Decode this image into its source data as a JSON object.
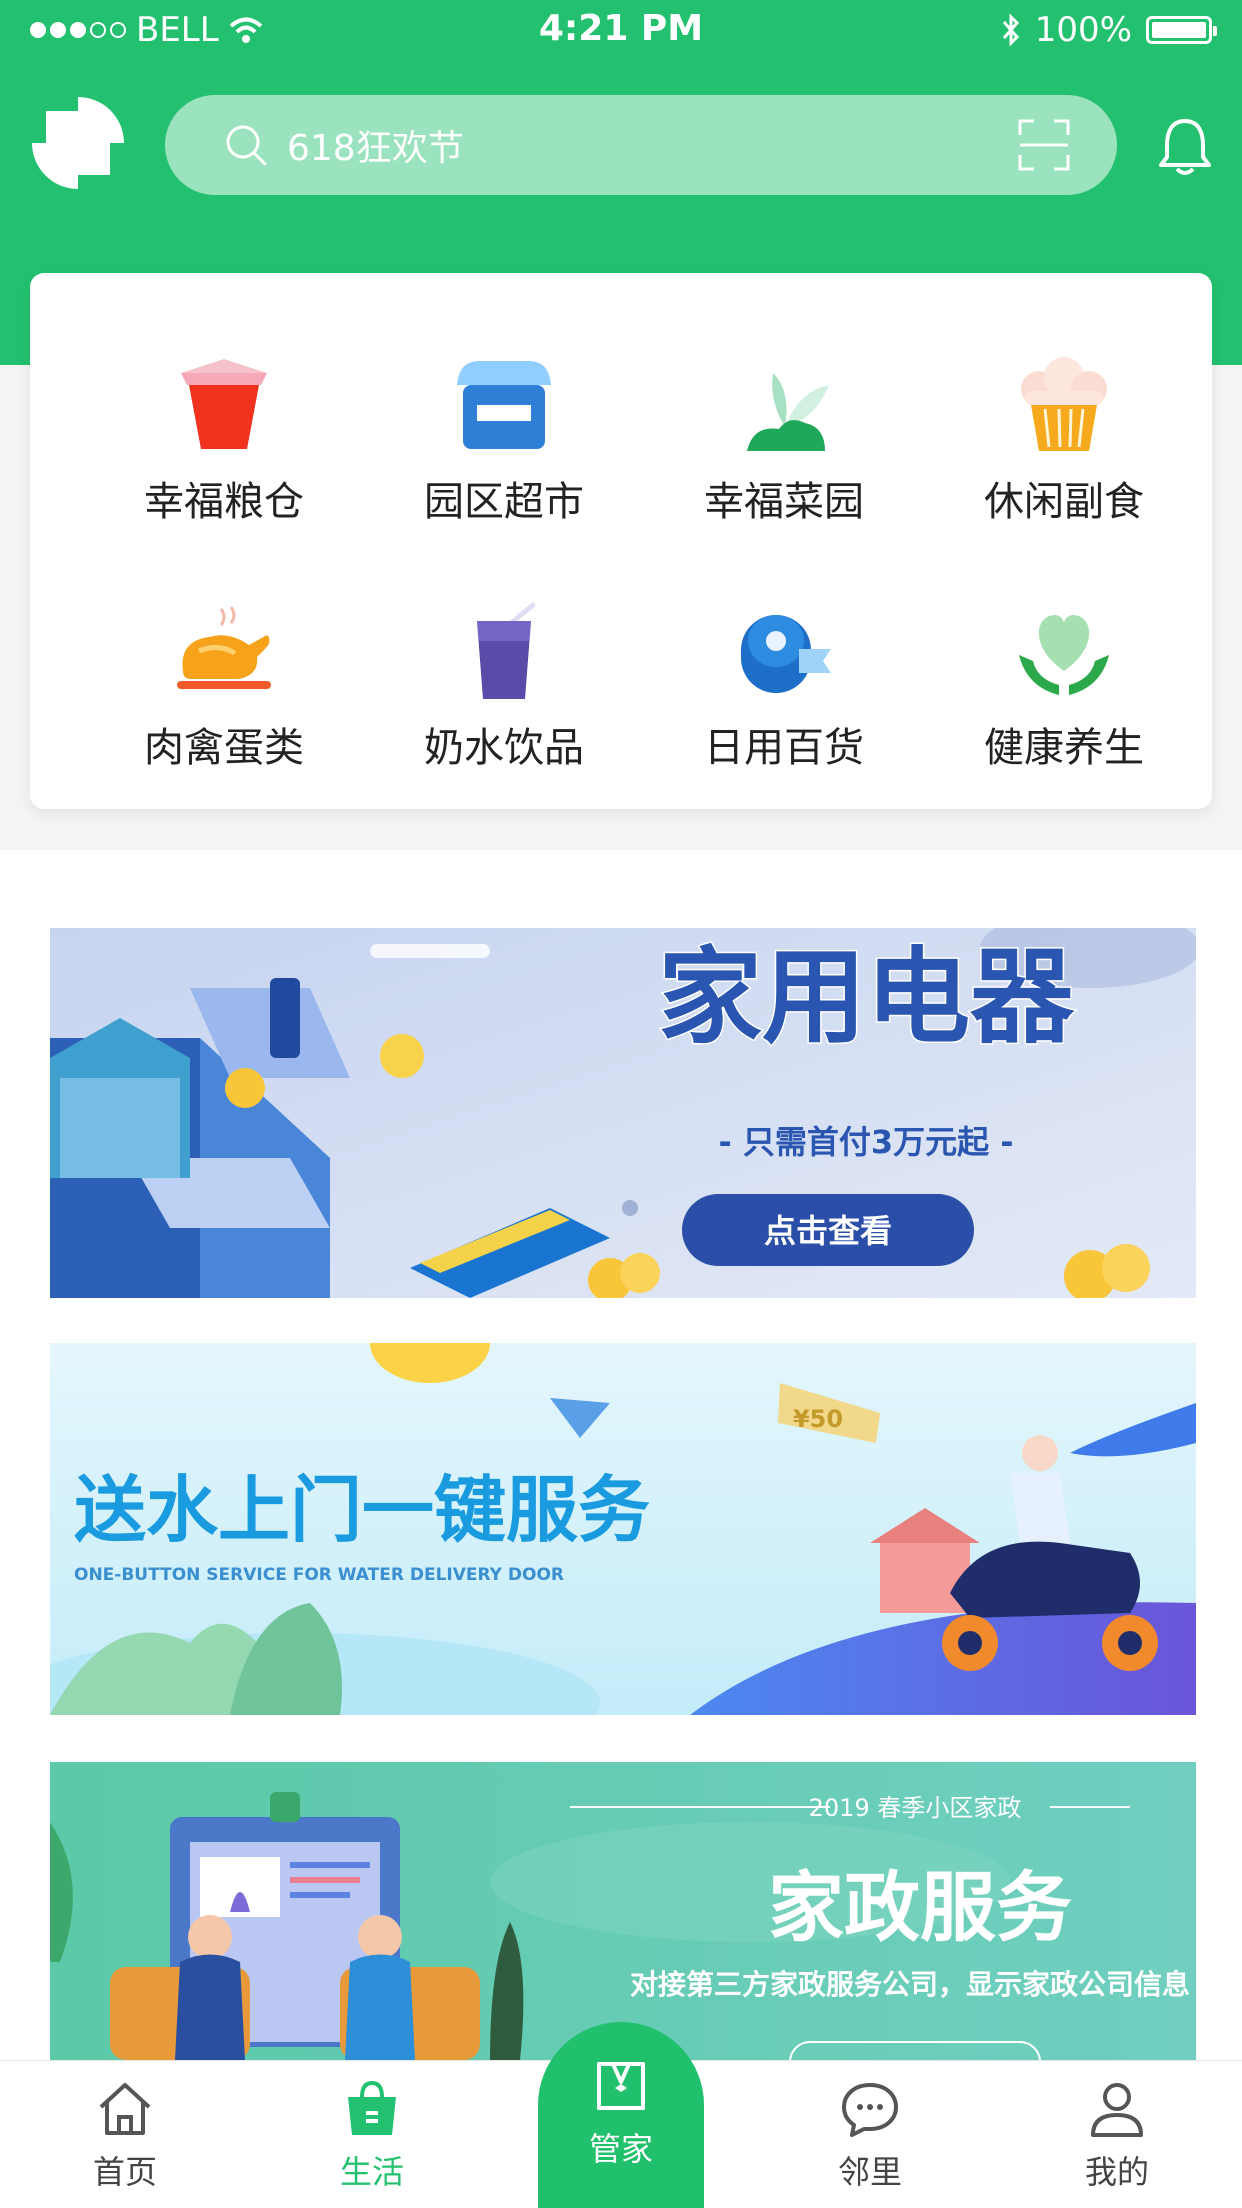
{
  "status_bar": {
    "carrier": "BELL",
    "time": "4:21 PM",
    "battery": "100%"
  },
  "search": {
    "placeholder": "618狂欢节"
  },
  "categories": [
    {
      "label": "幸福粮仓",
      "icon": "rice-bucket-icon"
    },
    {
      "label": "园区超市",
      "icon": "store-icon"
    },
    {
      "label": "幸福菜园",
      "icon": "plant-icon"
    },
    {
      "label": "休闲副食",
      "icon": "cupcake-icon"
    },
    {
      "label": "肉禽蛋类",
      "icon": "roast-chicken-icon"
    },
    {
      "label": "奶水饮品",
      "icon": "drink-cup-icon"
    },
    {
      "label": "日用百货",
      "icon": "tissue-roll-icon"
    },
    {
      "label": "健康养生",
      "icon": "heart-hands-icon"
    }
  ],
  "banners": [
    {
      "title": "家用电器",
      "subtitle": "- 只需首付3万元起 -",
      "button": "点击查看"
    },
    {
      "title": "送水上门一键服务",
      "subtitle": "ONE-BUTTON SERVICE FOR WATER DELIVERY DOOR",
      "coupon": "¥50"
    },
    {
      "tag": "2019 春季小区家政",
      "title": "家政服务",
      "subtitle": "对接第三方家政服务公司，显示家政公司信息"
    }
  ],
  "tabs": {
    "home": "首页",
    "life": "生活",
    "butler": "管家",
    "neighbor": "邻里",
    "mine": "我的"
  },
  "colors": {
    "brand_green": "#23c16f",
    "banner_blue": "#2a55b0",
    "water_blue": "#1a9be0"
  }
}
